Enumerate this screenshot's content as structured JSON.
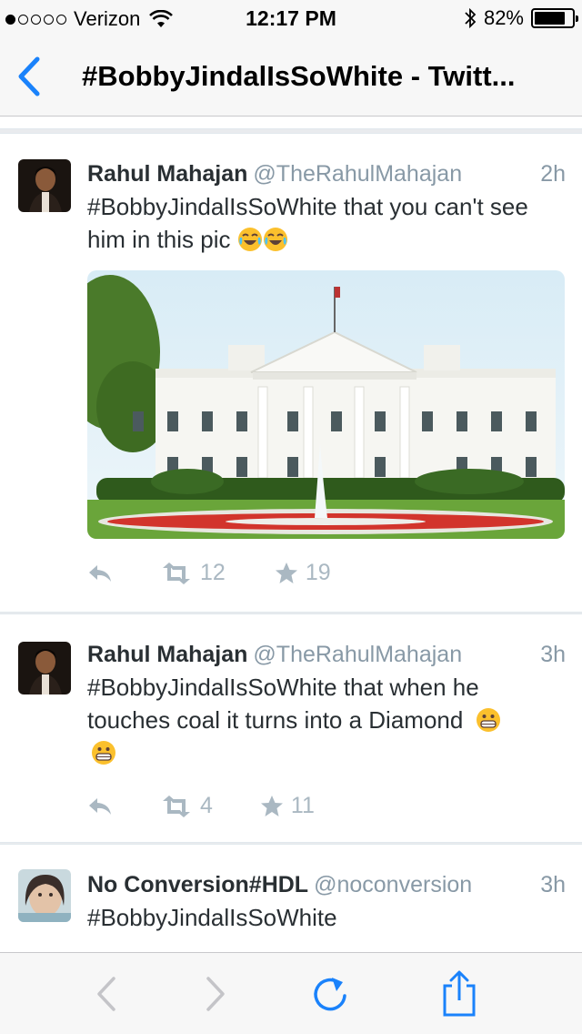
{
  "status_bar": {
    "carrier": "Verizon",
    "time": "12:17 PM",
    "battery": "82%",
    "battery_level": 0.82,
    "signal_bars_filled": 1,
    "signal_bars_total": 5
  },
  "nav": {
    "back_icon": "chevron-left-icon",
    "title": "#BobbyJindalIsSoWhite - Twitt..."
  },
  "accent_color": "#1a82fb",
  "tweets": [
    {
      "name": "Rahul Mahajan",
      "handle": "@TheRahulMahajan",
      "time": "2h",
      "text": "#BobbyJindalIsSoWhite that you can't see him in this pic",
      "emojis": [
        "tears-of-joy-emoji",
        "tears-of-joy-emoji"
      ],
      "media": "white-house-photo",
      "retweets": "12",
      "favorites": "19"
    },
    {
      "name": "Rahul Mahajan",
      "handle": "@TheRahulMahajan",
      "time": "3h",
      "text_line1": "#BobbyJindalIsSoWhite that when he",
      "text_line2": "touches coal it turns into a Diamond",
      "emojis": [
        "grimacing-emoji",
        "grimacing-emoji"
      ],
      "retweets": "4",
      "favorites": "11"
    },
    {
      "name": "No Conversion#HDL",
      "handle": "@noconversion",
      "time": "3h",
      "text": "#BobbyJindalIsSoWhite"
    }
  ],
  "toolbar": {
    "icons": [
      "back-arrow-icon",
      "forward-arrow-icon",
      "reload-icon",
      "share-icon"
    ]
  }
}
